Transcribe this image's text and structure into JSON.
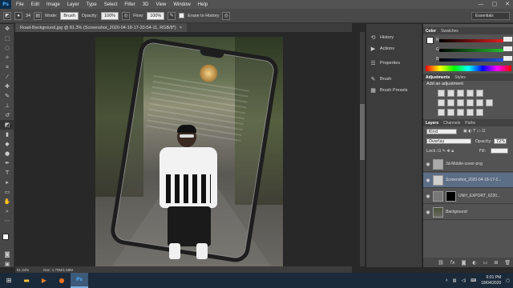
{
  "app": {
    "logo": "Ps"
  },
  "menu": [
    "File",
    "Edit",
    "Image",
    "Layer",
    "Type",
    "Select",
    "Filter",
    "3D",
    "View",
    "Window",
    "Help"
  ],
  "window_controls": [
    "—",
    "▢",
    "✕"
  ],
  "options": {
    "mode_label": "Mode:",
    "mode_value": "Brush",
    "opacity_label": "Opacity:",
    "opacity_value": "100%",
    "flow_label": "Flow:",
    "flow_value": "100%",
    "erase_history_label": "Erase to History",
    "workspace": "Essentials",
    "brush_size": "34"
  },
  "document": {
    "tab_title": "Road-Background.jpg @ 81.3% (Screenshot_2020-04-18-17-20-54-11, RGB/8*)",
    "zoom": "81.34%",
    "doc_info": "Doc: 1.70M/1.59M"
  },
  "icon_panels": [
    {
      "icon": "history-icon",
      "label": "History"
    },
    {
      "icon": "actions-icon",
      "label": "Actions"
    },
    {
      "icon": "properties-icon",
      "label": "Properties"
    },
    {
      "icon": "brush-icon",
      "label": "Brush"
    },
    {
      "icon": "brush-presets-icon",
      "label": "Brush Presets"
    }
  ],
  "color_panel": {
    "tabs": [
      "Color",
      "Swatches"
    ],
    "channels": [
      {
        "label": "R",
        "value": "",
        "color": "#d93030"
      },
      {
        "label": "G",
        "value": "",
        "color": "#30b040"
      },
      {
        "label": "B",
        "value": "",
        "color": "#3060d0"
      }
    ]
  },
  "adjustments": {
    "tabs": [
      "Adjustments",
      "Styles"
    ],
    "add_label": "Add an adjustment"
  },
  "layers_panel": {
    "tabs": [
      "Layers",
      "Channels",
      "Paths"
    ],
    "kind": "Kind",
    "blend_mode": "Overlay",
    "opacity_label": "Opacity:",
    "opacity_value": "72%",
    "fill_label": "Fill:",
    "fill_value": "",
    "lock_label": "Lock:",
    "layers": [
      {
        "name": "3d-Mobile-cover-png",
        "selected": false,
        "has_mask": false
      },
      {
        "name": "Screenshot_2020-04-18-17-2...",
        "selected": true,
        "has_mask": false
      },
      {
        "name": "UNH_EXPORT_6230...",
        "selected": false,
        "has_mask": true
      },
      {
        "name": "Background",
        "selected": false,
        "has_mask": false
      }
    ]
  },
  "taskbar": {
    "time": "6:01 PM",
    "date": "18/04/2020",
    "apps": [
      "start-icon",
      "file-explorer-icon",
      "media-player-icon",
      "firefox-icon",
      "photoshop-icon"
    ]
  }
}
